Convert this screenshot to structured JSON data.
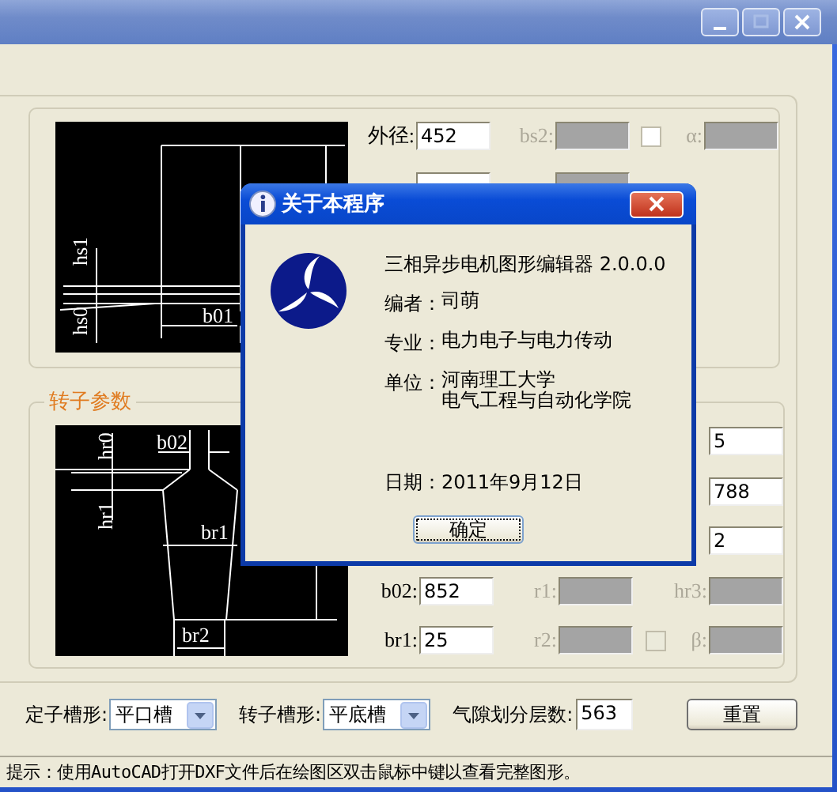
{
  "stator": {
    "drawing_labels": [
      "hs1",
      "hs0",
      "b01"
    ],
    "rows": [
      {
        "fields": [
          {
            "label": "外径:",
            "value": "452",
            "disabled": false
          },
          {
            "label": "bs2:",
            "disabled": true
          },
          {
            "label": "α:",
            "disabled": true
          }
        ],
        "checkbox": {
          "checked": false,
          "disabled": false
        }
      }
    ],
    "partial_row": [
      {
        "disabled": false
      },
      {
        "disabled": true
      }
    ]
  },
  "rotor": {
    "title": "转子参数",
    "drawing_labels": [
      "hr0",
      "b02",
      "hr1",
      "br1",
      "br2"
    ],
    "side_fields": [
      {
        "value": "5"
      },
      {
        "value": "788"
      },
      {
        "value": "2"
      }
    ],
    "rows": [
      {
        "fields": [
          {
            "label": "b02:",
            "value": "852",
            "disabled": false
          },
          {
            "label": "r1:",
            "disabled": true
          },
          {
            "label": "hr3:",
            "disabled": true
          }
        ]
      },
      {
        "fields": [
          {
            "label": "br1:",
            "value": "25",
            "disabled": false
          },
          {
            "label": "r2:",
            "disabled": true
          },
          {
            "label": "β:",
            "disabled": true
          }
        ],
        "checkbox": {
          "checked": false,
          "disabled": true
        }
      }
    ]
  },
  "slot_shapes": [
    {
      "label": "定子槽形:",
      "value": "平口槽"
    },
    {
      "label": "转子槽形:",
      "value": "平底槽"
    }
  ],
  "air_gap": {
    "label": "气隙划分层数:",
    "value": "563"
  },
  "reset_button": "重置",
  "status_bar": "提示：使用AutoCAD打开DXF文件后在绘图区双击鼠标中键以查看完整图形。",
  "about_dialog": {
    "title": "关于本程序",
    "product": "三相异步电机图形编辑器 2.0.0.0",
    "lines": [
      {
        "label": "编者：",
        "value": [
          "司萌"
        ]
      },
      {
        "label": "专业：",
        "value": [
          "电力电子与电力传动"
        ]
      },
      {
        "label": "单位：",
        "value": [
          "河南理工大学",
          "电气工程与自动化学院"
        ]
      }
    ],
    "date": {
      "label": "日期：",
      "value": "2011年9月12日"
    },
    "ok_button": "确定"
  }
}
